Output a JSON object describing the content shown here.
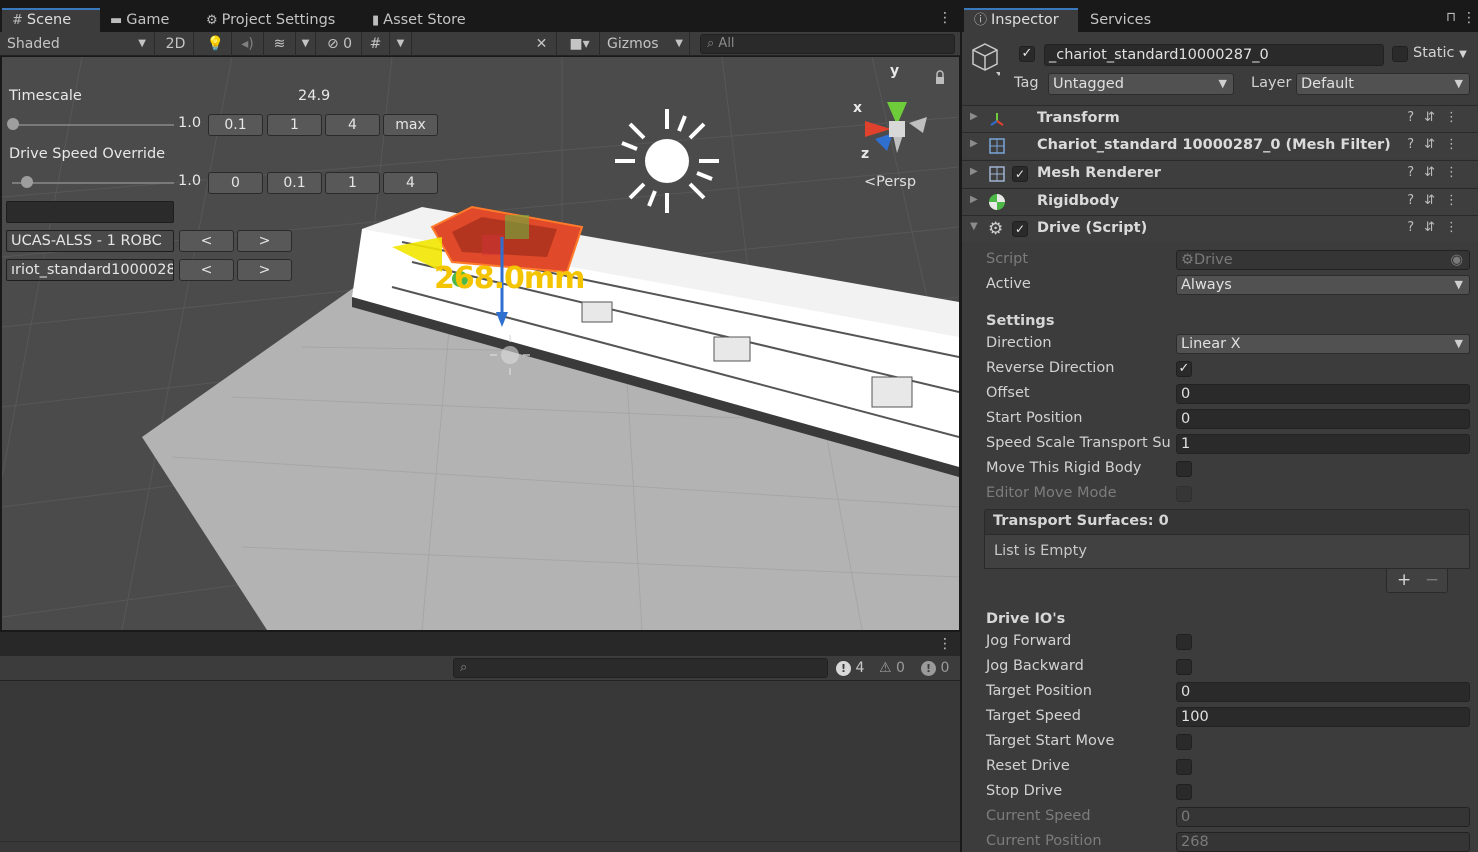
{
  "scene_tabs": [
    {
      "icon": "grid-icon",
      "label": "Scene"
    },
    {
      "icon": "gamepad-icon",
      "label": "Game"
    },
    {
      "icon": "gear-icon",
      "label": "Project Settings"
    },
    {
      "icon": "lock-icon",
      "label": "Asset Store"
    }
  ],
  "scene_toolbar": {
    "shading_mode": "Shaded",
    "mode_2d": "2D",
    "hidden_count": "0",
    "gizmos": "Gizmos",
    "search_placeholder": "All"
  },
  "overlay": {
    "timescale_label": "Timescale",
    "timescale_value": "24.9",
    "timescale_slider_value": "1.0",
    "timescale_buttons": [
      "0.1",
      "1",
      "4",
      "max"
    ],
    "drive_speed_label": "Drive Speed Override",
    "drive_speed_slider_value": "1.0",
    "drive_speed_buttons": [
      "0",
      "0.1",
      "1",
      "4"
    ],
    "robot_field": "UCAS-ALSS - 1 ROBC",
    "object_field": "ıriot_standard1000028",
    "prev": "<",
    "next": ">"
  },
  "viewport": {
    "measurement": "268.0mm",
    "persp_label": "Persp",
    "axis_x": "x",
    "axis_y": "y",
    "axis_z": "z"
  },
  "console": {
    "error_count": "4",
    "warning_count": "0",
    "info_count": "0"
  },
  "inspector_tabs": [
    {
      "icon": "info-icon",
      "label": "Inspector"
    },
    {
      "icon": "",
      "label": "Services"
    }
  ],
  "object": {
    "name": "_chariot_standard10000287_0",
    "active": true,
    "static_label": "Static",
    "tag_label": "Tag",
    "tag_value": "Untagged",
    "layer_label": "Layer",
    "layer_value": "Default"
  },
  "components": [
    {
      "name": "Transform",
      "icon": "transform-icon",
      "checkbox": false
    },
    {
      "name": "Chariot_standard 10000287_0 (Mesh Filter)",
      "icon": "mesh-filter-icon",
      "checkbox": false
    },
    {
      "name": "Mesh Renderer",
      "icon": "mesh-renderer-icon",
      "checkbox": true
    },
    {
      "name": "Rigidbody",
      "icon": "rigidbody-icon",
      "checkbox": false
    },
    {
      "name": "Drive (Script)",
      "icon": "script-gear-icon",
      "checkbox": true
    }
  ],
  "drive": {
    "script_label": "Script",
    "script_value": "Drive",
    "active_label": "Active",
    "active_value": "Always",
    "settings_title": "Settings",
    "direction_label": "Direction",
    "direction_value": "Linear X",
    "reverse_label": "Reverse Direction",
    "reverse_checked": true,
    "offset_label": "Offset",
    "offset_value": "0",
    "start_position_label": "Start Position",
    "start_position_value": "0",
    "speed_scale_label": "Speed Scale Transport Su",
    "speed_scale_value": "1",
    "move_rigid_label": "Move This Rigid Body",
    "editor_move_label": "Editor Move Mode",
    "transport_title": "Transport Surfaces: 0",
    "list_empty": "List is Empty",
    "add": "+",
    "remove": "−",
    "io_title": "Drive IO's",
    "jog_forward_label": "Jog Forward",
    "jog_backward_label": "Jog Backward",
    "target_position_label": "Target Position",
    "target_position_value": "0",
    "target_speed_label": "Target Speed",
    "target_speed_value": "100",
    "target_start_label": "Target Start Move",
    "reset_drive_label": "Reset Drive",
    "stop_drive_label": "Stop Drive",
    "current_speed_label": "Current Speed",
    "current_speed_value": "0",
    "current_position_label": "Current Position",
    "current_position_value": "268"
  },
  "colors": {
    "accent": "#3a79bb",
    "measurement": "#f5c400",
    "panel": "#3c3c3c",
    "field": "#2a2a2a"
  }
}
